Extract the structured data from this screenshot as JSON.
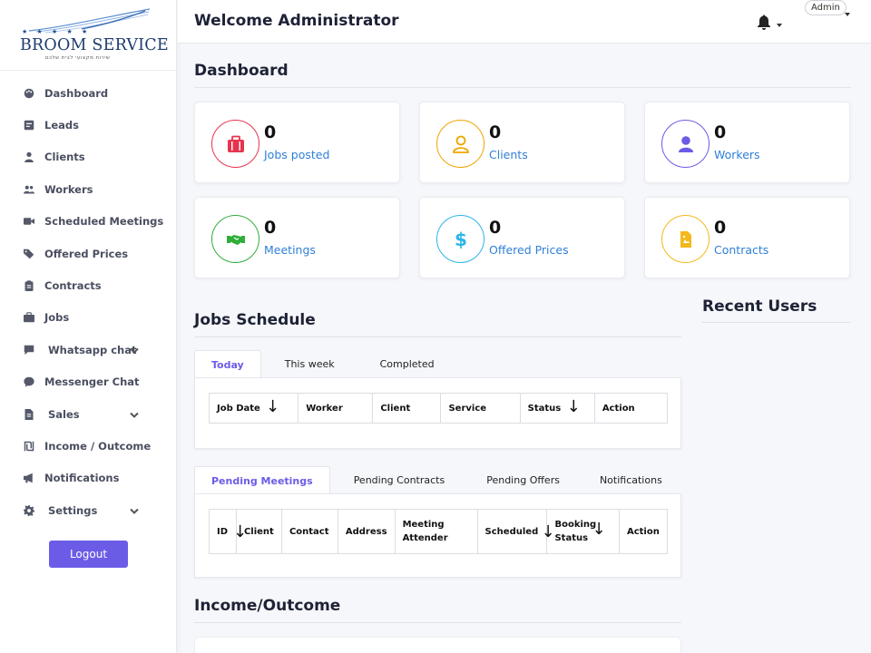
{
  "brand": {
    "name": "BROOM SERVICE",
    "stars": "★ ★ ★ ★ ★",
    "subtitle": "שירות מקצועי לבית שלכם"
  },
  "sidebar": {
    "items": [
      {
        "label": "Dashboard",
        "icon": "palette-icon"
      },
      {
        "label": "Leads",
        "icon": "lead-icon"
      },
      {
        "label": "Clients",
        "icon": "user-icon"
      },
      {
        "label": "Workers",
        "icon": "users-icon"
      },
      {
        "label": "Scheduled Meetings",
        "icon": "video-icon"
      },
      {
        "label": "Offered Prices",
        "icon": "tags-icon"
      },
      {
        "label": "Contracts",
        "icon": "clipboard-icon"
      },
      {
        "label": "Jobs",
        "icon": "briefcase-icon"
      },
      {
        "label": "Whatsapp chat",
        "icon": "chat-icon",
        "expandable": true
      },
      {
        "label": "Messenger Chat",
        "icon": "messenger-icon"
      },
      {
        "label": "Sales",
        "icon": "file-icon",
        "expandable": true
      },
      {
        "label": "Income / Outcome",
        "icon": "shekel-icon"
      },
      {
        "label": "Notifications",
        "icon": "megaphone-icon"
      },
      {
        "label": "Settings",
        "icon": "gear-icon",
        "expandable": true
      }
    ],
    "logout_label": "Logout"
  },
  "topbar": {
    "welcome": "Welcome Administrator",
    "admin_label": "Admin"
  },
  "dashboard": {
    "title": "Dashboard",
    "cards": [
      {
        "value": "0",
        "label": "Jobs posted",
        "icon": "briefcase-icon",
        "color": "#e8334f"
      },
      {
        "value": "0",
        "label": "Clients",
        "icon": "user-icon",
        "color": "#f0a500"
      },
      {
        "value": "0",
        "label": "Workers",
        "icon": "user-icon",
        "color": "#6b5ce7"
      },
      {
        "value": "0",
        "label": "Meetings",
        "icon": "handshake-icon",
        "color": "#2fae3a"
      },
      {
        "value": "0",
        "label": "Offered Prices",
        "icon": "dollar-icon",
        "color": "#2bb5e8"
      },
      {
        "value": "0",
        "label": "Contracts",
        "icon": "file-icon",
        "color": "#f3b81c"
      }
    ]
  },
  "jobs_schedule": {
    "title": "Jobs Schedule",
    "tabs": [
      "Today",
      "This week",
      "Completed"
    ],
    "active_tab": "Today",
    "columns": [
      "Job Date",
      "Worker",
      "Client",
      "Service",
      "Status",
      "Action"
    ]
  },
  "meetings": {
    "tabs": [
      "Pending Meetings",
      "Pending Contracts",
      "Pending Offers",
      "Notifications"
    ],
    "active_tab": "Pending Meetings",
    "columns": [
      "ID",
      "Client",
      "Contact",
      "Address",
      "Meeting Attender",
      "Scheduled",
      "Booking Status",
      "Action"
    ]
  },
  "recent_users": {
    "title": "Recent Users"
  },
  "income": {
    "title": "Income/Outcome"
  },
  "colors": {
    "accent": "#6b5ce7",
    "link": "#2e7fd6"
  }
}
